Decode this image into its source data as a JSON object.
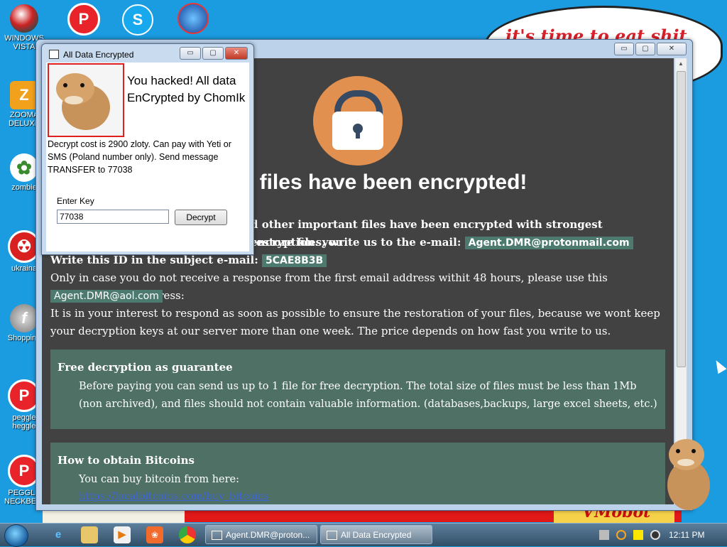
{
  "wallpaper": {
    "bubble_text": "it's time to eat shit",
    "bottom_text": "VMobot"
  },
  "desktop_icons": [
    {
      "label": "WINDOWS VISTA",
      "icon": "vista-ball-icon"
    },
    {
      "label": "ZOOMA DELUXE",
      "icon": "zooma-icon"
    },
    {
      "label": "zombie",
      "icon": "flower-icon"
    },
    {
      "label": "ukraina",
      "icon": "radiation-icon"
    },
    {
      "label": "Shopping",
      "icon": "flash-icon"
    },
    {
      "label": "peggle heggle",
      "icon": "peggle-icon"
    },
    {
      "label": "PEGGLE NECKBEARD",
      "icon": "peggle-icon"
    }
  ],
  "top_icons": [
    "peggle-icon",
    "skype-icon",
    "network-globe-icon"
  ],
  "ransom_window": {
    "title": "Agent.DMR@protonmail.com",
    "heading": "Your files have been encrypted!",
    "heading_visible": "r files have been encrypted!",
    "line1": "d other important files have been encrypted with strongest encryption. you",
    "line2_prefix": "restore files, write us to the e-mail:",
    "email_primary": "Agent.DMR@protonmail.com",
    "id_label": "Write this ID in the subject e-mail:",
    "id_value": "5CAE8B3B",
    "alt_text": "Only in case you do not receive a response from the first email address withit 48 hours, please use this alternative email adress:",
    "email_alt": "Agent.DMR@aol.com",
    "interest_text": "It is in your interest to respond as soon as possible to ensure the restoration of your files, because we wont keep your decryption keys at our server more than one week. The price depends on how fast you write to us.",
    "panels": [
      {
        "title": "Free decryption as guarantee",
        "body": "Before paying you can send us up to 1 file for free decryption. The total size of files must be less than 1Mb (non archived), and files should not contain valuable information. (databases,backups, large excel sheets, etc.)"
      },
      {
        "title": "How to obtain Bitcoins",
        "body": "You can buy bitcoin from here:",
        "link": "https://localbitcoins.com/buy_bitcoins"
      }
    ]
  },
  "chomik_window": {
    "title": "All Data Encrypted",
    "headline_line1": "You hacked! All data",
    "headline_line2": "EnCrypted by ChomIk",
    "description": "Decrypt cost is 2900 zloty. Can pay with Yeti or SMS (Poland number only). Send message TRANSFER to 77038",
    "key_label": "Enter Key",
    "key_value": "77038",
    "decrypt_label": "Decrypt"
  },
  "window_buttons": {
    "minimize": "▭",
    "maximize": "▢",
    "close": "✕"
  },
  "taskbar": {
    "tasks": [
      {
        "label": "Agent.DMR@proton..."
      },
      {
        "label": "All Data Encrypted"
      }
    ],
    "clock": "12:11 PM"
  }
}
